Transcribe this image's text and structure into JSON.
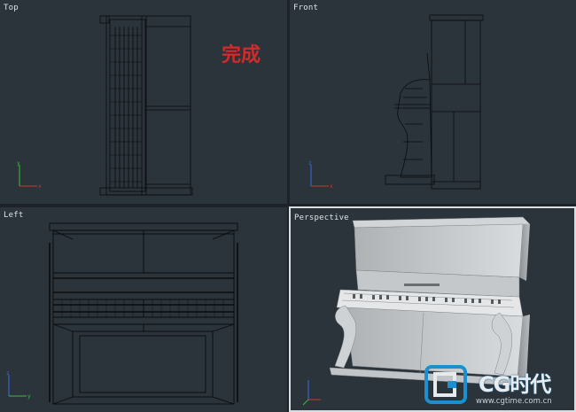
{
  "viewports": {
    "top": {
      "label": "Top"
    },
    "front": {
      "label": "Front"
    },
    "left": {
      "label": "Left"
    },
    "perspective": {
      "label": "Perspective"
    }
  },
  "annotation": {
    "text": "完成",
    "color": "#d32a2a"
  },
  "watermark": {
    "brand": "CG时代",
    "url": "www.cgtime.com.cn"
  },
  "colors": {
    "viewport_bg": "#2b333b",
    "frame_bg": "#1d2329",
    "wireframe": "#0a0c0e",
    "active_border": "#d9dde0",
    "axis_x": "#d23a2a",
    "axis_y": "#3bbf3b",
    "axis_z": "#3b6ee0"
  },
  "icons": [
    "axis-gizmo-icon",
    "cg-logo-icon"
  ]
}
